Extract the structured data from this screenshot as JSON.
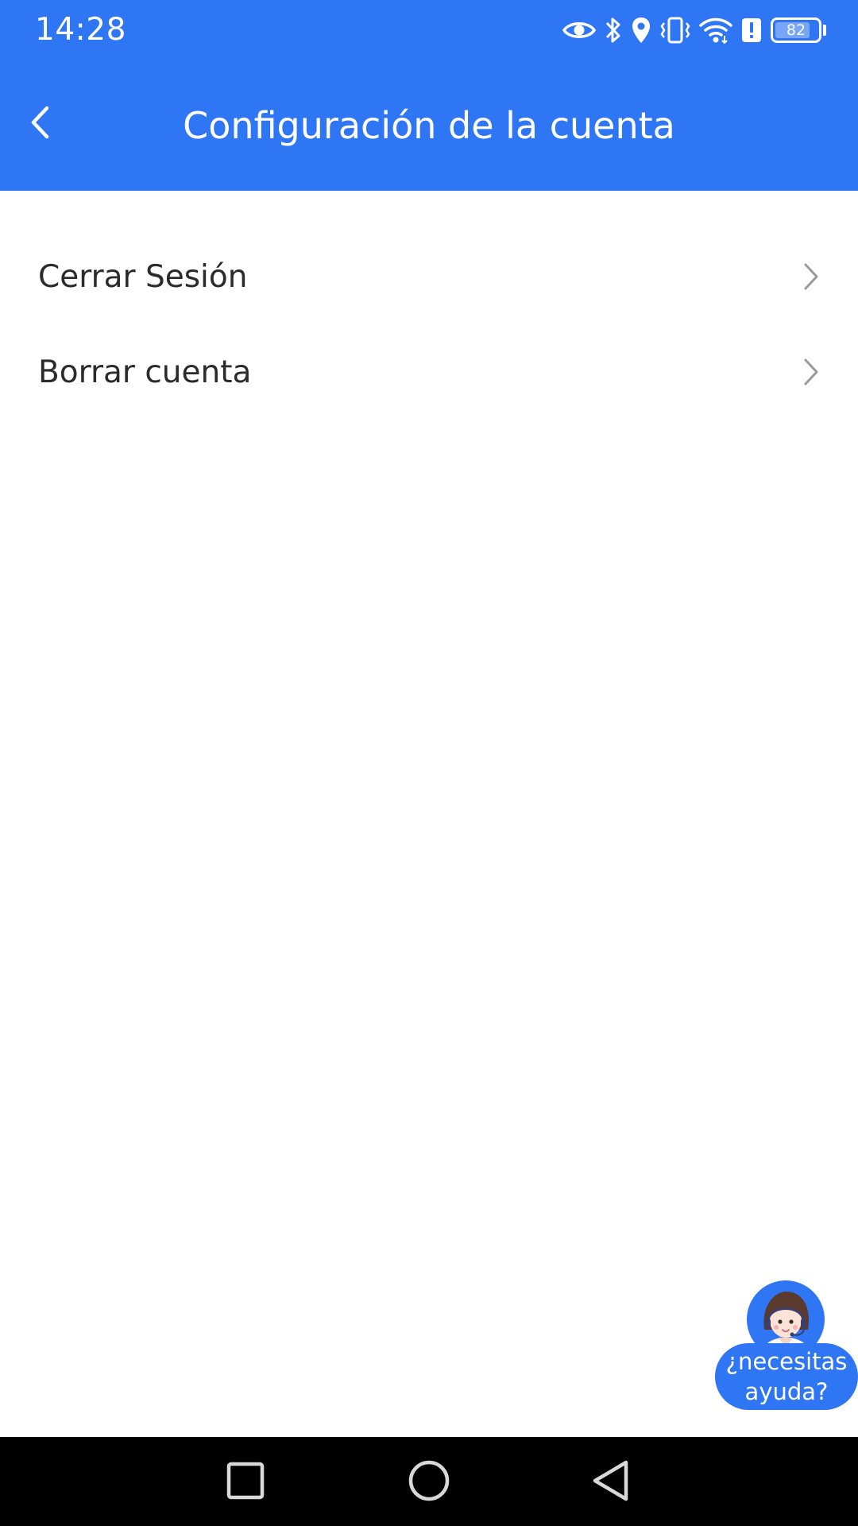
{
  "status_bar": {
    "time": "14:28",
    "battery_level": "82",
    "icons": [
      "eye-icon",
      "bluetooth-icon",
      "location-icon",
      "vibrate-icon",
      "wifi-icon",
      "alert-icon",
      "battery-icon"
    ]
  },
  "app_bar": {
    "title": "Configuración de la cuenta",
    "back_icon": "chevron-left-icon"
  },
  "menu": {
    "items": [
      {
        "label": "Cerrar Sesión",
        "icon": "chevron-right-icon"
      },
      {
        "label": "Borrar cuenta",
        "icon": "chevron-right-icon"
      }
    ]
  },
  "help_button": {
    "text": "¿necesitas\nayuda?",
    "avatar_icon": "support-agent-avatar"
  },
  "nav_bar": {
    "recents_icon": "square-icon",
    "home_icon": "circle-icon",
    "back_icon": "triangle-back-icon"
  },
  "colors": {
    "primary": "#2f76f5",
    "text": "#2b2b2b",
    "chevron": "#9a9a9a",
    "nav_background": "#000000"
  }
}
